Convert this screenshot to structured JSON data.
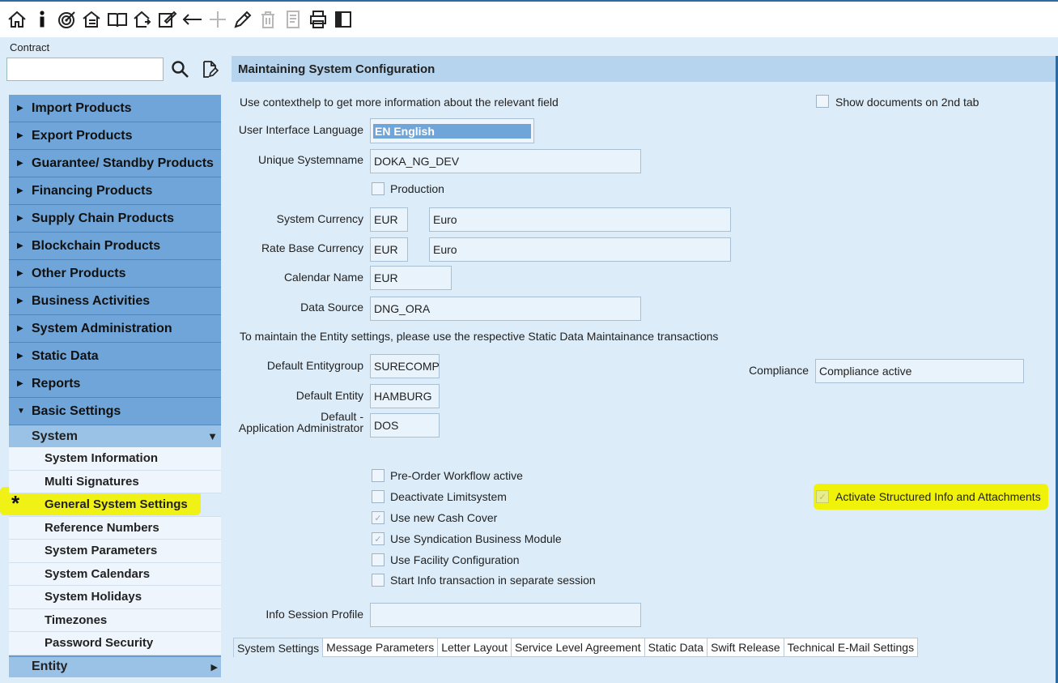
{
  "toolbar": {
    "icons": [
      "home-icon",
      "info-icon",
      "target-icon",
      "tree-icon",
      "book-icon",
      "transfer-icon",
      "edit-icon",
      "back-arrow-icon",
      "add-icon",
      "pencil-icon",
      "trash-icon",
      "report-icon",
      "print-icon",
      "panel-icon"
    ]
  },
  "left": {
    "contract_label": "Contract",
    "contract_value": "",
    "categories": [
      "Import Products",
      "Export Products",
      "Guarantee/ Standby Products",
      "Financing Products",
      "Supply Chain Products",
      "Blockchain Products",
      "Other Products",
      "Business Activities",
      "System Administration",
      "Static Data",
      "Reports"
    ],
    "expanded_category": "Basic Settings",
    "sub_group": "System",
    "sub_items": [
      "System Information",
      "Multi Signatures",
      "General System Settings",
      "Reference Numbers",
      "System Parameters",
      "System Calendars",
      "System Holidays",
      "Timezones",
      "Password Security"
    ],
    "next_group": "Entity",
    "star_marker": "*"
  },
  "main": {
    "title": "Maintaining System Configuration",
    "help_text": "Use contexthelp to get more information about the relevant field",
    "show_documents_label": "Show documents on 2nd tab",
    "ui_language_label": "User Interface Language",
    "ui_language_value": "EN English",
    "unique_systemname_label": "Unique Systemname",
    "unique_systemname_value": "DOKA_NG_DEV",
    "production_label": "Production",
    "system_currency_label": "System Currency",
    "system_currency_code": "EUR",
    "system_currency_name": "Euro",
    "rate_base_currency_label": "Rate Base Currency",
    "rate_base_currency_code": "EUR",
    "rate_base_currency_name": "Euro",
    "calendar_name_label": "Calendar Name",
    "calendar_name_value": "EUR",
    "data_source_label": "Data Source",
    "data_source_value": "DNG_ORA",
    "entity_note": "To maintain the Entity settings, please use the respective Static Data Maintainance transactions",
    "default_entitygroup_label": "Default Entitygroup",
    "default_entitygroup_value": "SURECOMP",
    "compliance_label": "Compliance",
    "compliance_value": "Compliance active",
    "default_entity_label": "Default Entity",
    "default_entity_value": "HAMBURG",
    "default_admin_label_1": "Default -",
    "default_admin_label_2": "Application Administrator",
    "default_admin_value": "DOS",
    "pre_order_label": "Pre-Order Workflow active",
    "deactivate_limit_label": "Deactivate Limitsystem",
    "cash_cover_label": "Use new Cash Cover",
    "syndication_label": "Use Syndication Business Module",
    "facility_label": "Use Facility Configuration",
    "start_info_label": "Start Info transaction in separate session",
    "structured_info_label": "Activate Structured Info and Attachments",
    "info_session_label": "Info Session Profile",
    "info_session_value": "",
    "checkmark": "✓"
  },
  "tabs": [
    "System Settings",
    "Message Parameters",
    "Letter Layout",
    "Service Level Agreement",
    "Static Data",
    "Swift Release",
    "Technical E-Mail Settings"
  ]
}
